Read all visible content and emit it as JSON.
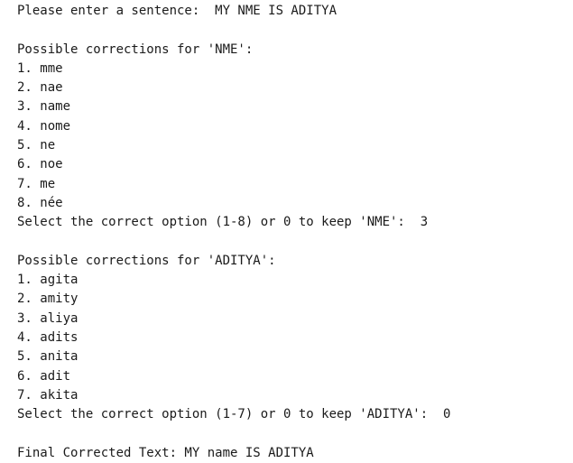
{
  "prompt": {
    "label": "Please enter a sentence: ",
    "input": " MY NME IS ADITYA"
  },
  "block1": {
    "header": "Possible corrections for 'NME':",
    "options": [
      "1. mme",
      "2. nae",
      "3. name",
      "4. nome",
      "5. ne",
      "6. noe",
      "7. me",
      "8. née"
    ],
    "select_prompt": "Select the correct option (1-8) or 0 to keep 'NME': ",
    "select_input": " 3"
  },
  "block2": {
    "header": "Possible corrections for 'ADITYA':",
    "options": [
      "1. agita",
      "2. amity",
      "3. aliya",
      "4. adits",
      "5. anita",
      "6. adit",
      "7. akita"
    ],
    "select_prompt": "Select the correct option (1-7) or 0 to keep 'ADITYA': ",
    "select_input": " 0"
  },
  "final": "Final Corrected Text: MY name IS ADITYA"
}
